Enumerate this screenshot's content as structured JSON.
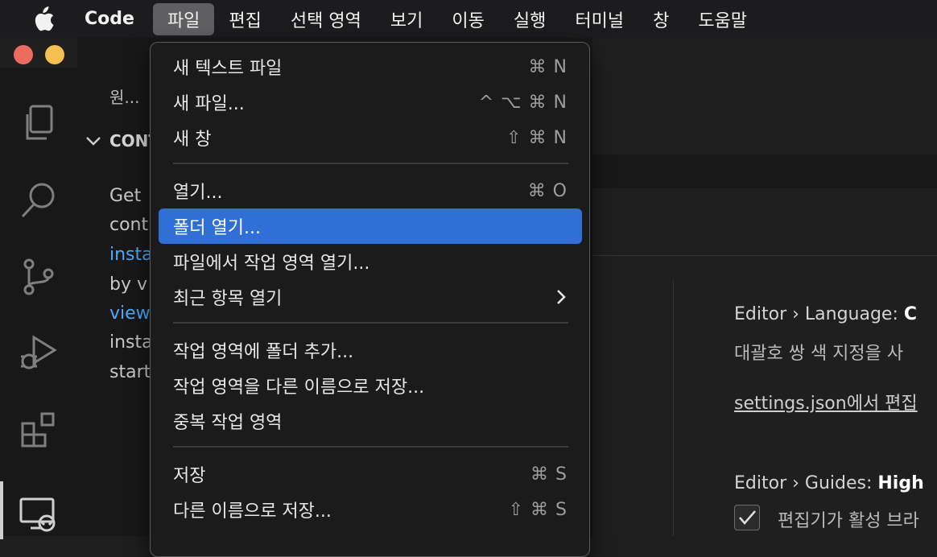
{
  "menubar": {
    "app_name": "Code",
    "items": [
      "파일",
      "편집",
      "선택 영역",
      "보기",
      "이동",
      "실행",
      "터미널",
      "창",
      "도움말"
    ]
  },
  "sidebar": {
    "title": "원...",
    "section": "CONT",
    "lines": [
      "Get",
      "cont",
      "insta",
      "by v",
      "view",
      "insta",
      "start"
    ]
  },
  "settings": {
    "item1_title_prefix": "Editor › Language:",
    "item1_title_bold": "C",
    "item1_desc": "대괄호 쌍 색 지정을 사",
    "item1_link": "settings.json에서 편집",
    "item2_title_prefix": "Editor › Guides:",
    "item2_title_bold": "High",
    "item2_checkbox_label": "편집기가 활성 브라"
  },
  "file_menu": {
    "items": [
      {
        "label": "새 텍스트 파일",
        "shortcut": "⌘ N"
      },
      {
        "label": "새 파일...",
        "shortcut": "^ ⌥ ⌘ N"
      },
      {
        "label": "새 창",
        "shortcut": "⇧ ⌘ N"
      },
      {
        "label": "열기...",
        "shortcut": "⌘ O"
      },
      {
        "label": "폴더 열기...",
        "shortcut": ""
      },
      {
        "label": "파일에서 작업 영역 열기...",
        "shortcut": ""
      },
      {
        "label": "최근 항목 열기",
        "shortcut": ""
      },
      {
        "label": "작업 영역에 폴더 추가...",
        "shortcut": ""
      },
      {
        "label": "작업 영역을 다른 이름으로 저장...",
        "shortcut": ""
      },
      {
        "label": "중복 작업 영역",
        "shortcut": ""
      },
      {
        "label": "저장",
        "shortcut": "⌘ S"
      },
      {
        "label": "다른 이름으로 저장...",
        "shortcut": "⇧ ⌘ S"
      }
    ]
  },
  "colors": {
    "highlight": "#2f6fd6",
    "link": "#4daafc",
    "menu_bg": "#1b1b1c"
  }
}
